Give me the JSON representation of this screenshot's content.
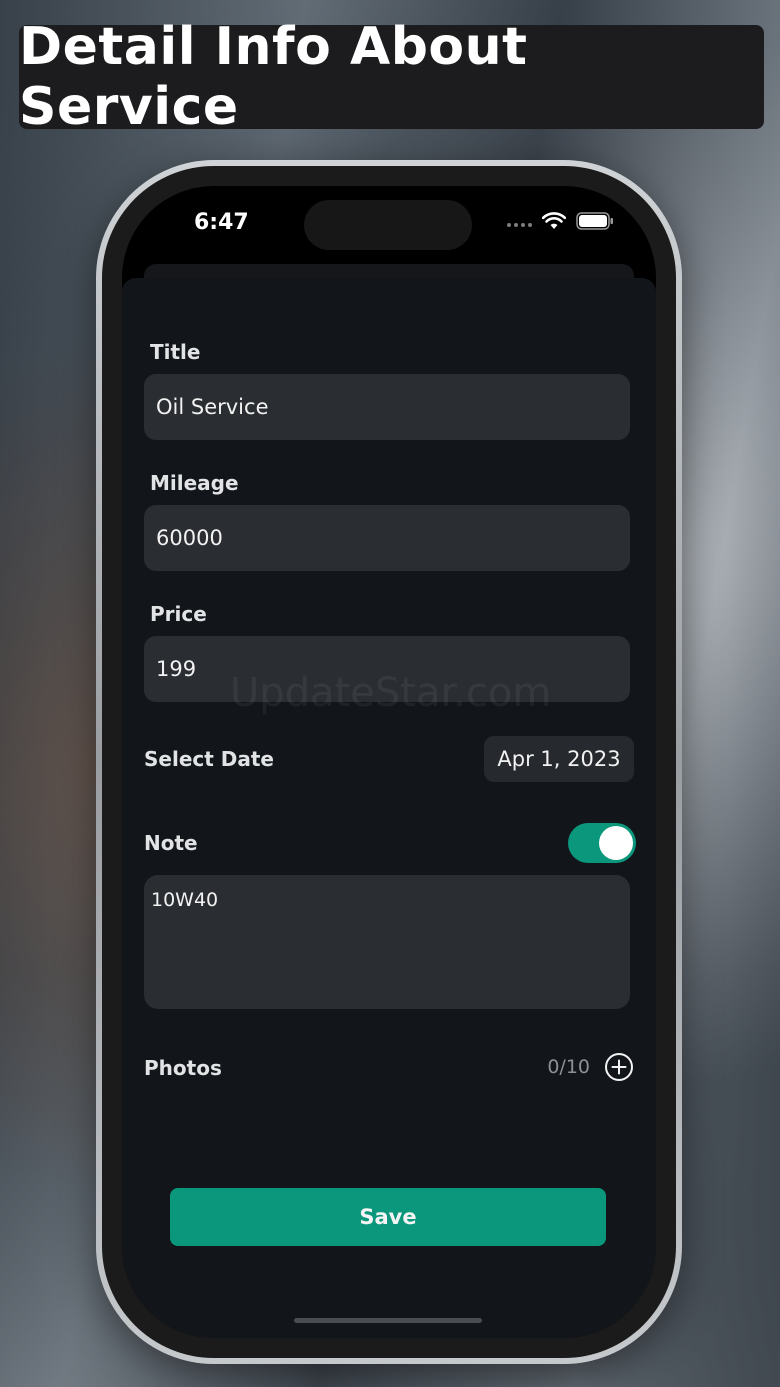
{
  "banner": {
    "title": "Detail Info About Service"
  },
  "status_bar": {
    "time": "6:47",
    "icons": [
      "signal-dots-icon",
      "wifi-icon",
      "battery-icon"
    ]
  },
  "form": {
    "title": {
      "label": "Title",
      "value": "Oil Service"
    },
    "mileage": {
      "label": "Mileage",
      "value": "60000"
    },
    "price": {
      "label": "Price",
      "value": "199"
    },
    "date": {
      "label": "Select Date",
      "value": "Apr 1, 2023"
    },
    "note": {
      "label": "Note",
      "enabled": true,
      "value": "10W40"
    },
    "photos": {
      "label": "Photos",
      "count": "0/10",
      "add_icon": "plus-circle-icon"
    },
    "save_label": "Save"
  },
  "watermark": "UpdateStar.com",
  "colors": {
    "accent": "#0b977b",
    "sheet_background": "#12161b",
    "field_background": "#2a2d32",
    "banner_background": "#1c1c1e"
  }
}
